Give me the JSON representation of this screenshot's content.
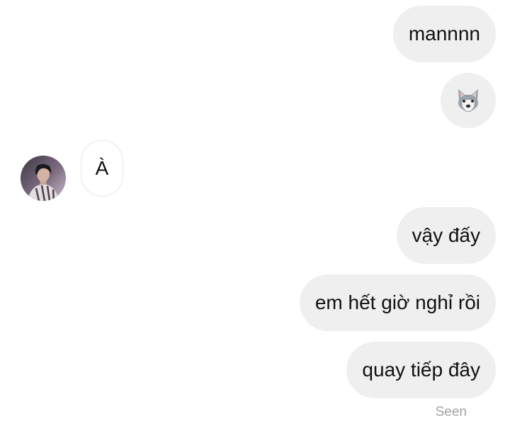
{
  "messages": [
    {
      "direction": "outgoing",
      "text": "mannnn"
    },
    {
      "direction": "outgoing",
      "type": "emoji",
      "icon": "wolf-face-icon"
    },
    {
      "direction": "incoming",
      "text": "À"
    },
    {
      "direction": "outgoing",
      "text": "vậy đấy"
    },
    {
      "direction": "outgoing",
      "text": "em hết giờ nghỉ rồi"
    },
    {
      "direction": "outgoing",
      "text": "quay tiếp đây"
    }
  ],
  "status": {
    "seen": "Seen"
  },
  "colors": {
    "outgoing_bubble": "#efefef",
    "incoming_bubble_border": "#e6e6e6",
    "seen_text": "#a3a3a3"
  }
}
